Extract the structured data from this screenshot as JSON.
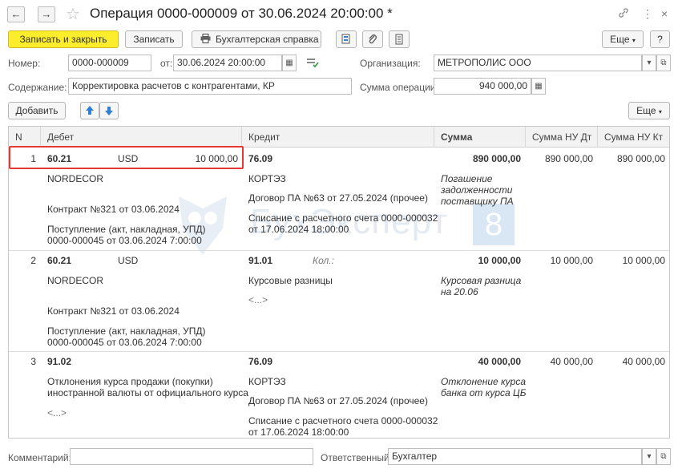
{
  "window": {
    "title": "Операция 0000-000009 от 30.06.2024 20:00:00 *",
    "back_glyph": "←",
    "forward_glyph": "→",
    "star_glyph": "☆",
    "link_glyph": "🔗",
    "more_glyph": "⋮",
    "close_glyph": "×"
  },
  "toolbar": {
    "save_close": "Записать и закрыть",
    "save": "Записать",
    "report": "Бухгалтерская справка",
    "more": "Еще",
    "help": "?"
  },
  "form": {
    "number_label": "Номер:",
    "number_value": "0000-000009",
    "date_label": "от:",
    "date_value": "30.06.2024 20:00:00",
    "org_label": "Организация:",
    "org_value": "МЕТРОПОЛИС ООО",
    "content_label": "Содержание:",
    "content_value": "Корректировка расчетов с контрагентами, КР",
    "sum_label": "Сумма операции:",
    "sum_value": "940 000,00"
  },
  "table_toolbar": {
    "add": "Добавить",
    "up": "↑",
    "down": "↓",
    "more": "Еще"
  },
  "table": {
    "headers": [
      "N",
      "Дебет",
      "Кредит",
      "Сумма",
      "Сумма НУ Дт",
      "Сумма НУ Кт"
    ],
    "rows": [
      {
        "n": "1",
        "debit_account": "60.21",
        "debit_currency": "USD",
        "debit_currency_amount": "10 000,00",
        "debit_sub1": "NORDECOR",
        "debit_sub2": "Контракт №321 от 03.06.2024",
        "debit_sub3_line1": "Поступление (акт, накладная, УПД)",
        "debit_sub3_line2": "0000-000045 от 03.06.2024 7:00:00",
        "credit_account": "76.09",
        "credit_qty": "",
        "credit_sub1": "КОРТЭЗ",
        "credit_sub2": "Договор ПА №63 от 27.05.2024 (прочее)",
        "credit_sub3_line1": "Списание с расчетного счета 0000-000032",
        "credit_sub3_line2": "от 17.06.2024 18:00:00",
        "sum": "890 000,00",
        "comment_line1": "Погашение",
        "comment_line2": "задолженности",
        "comment_line3": "поставщику ПА",
        "nu_dt": "890 000,00",
        "nu_kt": "890 000,00"
      },
      {
        "n": "2",
        "debit_account": "60.21",
        "debit_currency": "USD",
        "debit_sub1": "NORDECOR",
        "debit_sub2": "Контракт №321 от 03.06.2024",
        "debit_sub3_line1": "Поступление (акт, накладная, УПД)",
        "debit_sub3_line2": "0000-000045 от 03.06.2024 7:00:00",
        "credit_account": "91.01",
        "credit_qty": "Кол.:",
        "credit_sub1": "Курсовые разницы",
        "credit_sub2": "<...>",
        "sum": "10 000,00",
        "comment_line1": "Курсовая разница",
        "comment_line2": "на 20.06",
        "nu_dt": "10 000,00",
        "nu_kt": "10 000,00"
      },
      {
        "n": "3",
        "debit_account": "91.02",
        "debit_sub1_line1": "Отклонения курса продажи (покупки)",
        "debit_sub1_line2": "иностранной валюты от официального курса",
        "debit_sub2": "<...>",
        "credit_account": "76.09",
        "credit_sub1": "КОРТЭЗ",
        "credit_sub2": "Договор ПА №63 от 27.05.2024 (прочее)",
        "credit_sub3_line1": "Списание с расчетного счета 0000-000032",
        "credit_sub3_line2": "от 17.06.2024 18:00:00",
        "sum": "40 000,00",
        "comment_line1": "Отклонение курса",
        "comment_line2": "банка от курса ЦБ",
        "nu_dt": "40 000,00",
        "nu_kt": "40 000,00"
      }
    ]
  },
  "footer": {
    "comment_label": "Комментарий:",
    "comment_value": "",
    "responsible_label": "Ответственный:",
    "responsible_value": "Бухгалтер"
  },
  "watermark": {
    "text": "БухЭксперт",
    "digit": "8"
  },
  "colors": {
    "primary_button": "#fbed2c",
    "highlight": "#e53935",
    "up_arrow": "#2f7fd4",
    "down_arrow": "#2f7fd4"
  }
}
